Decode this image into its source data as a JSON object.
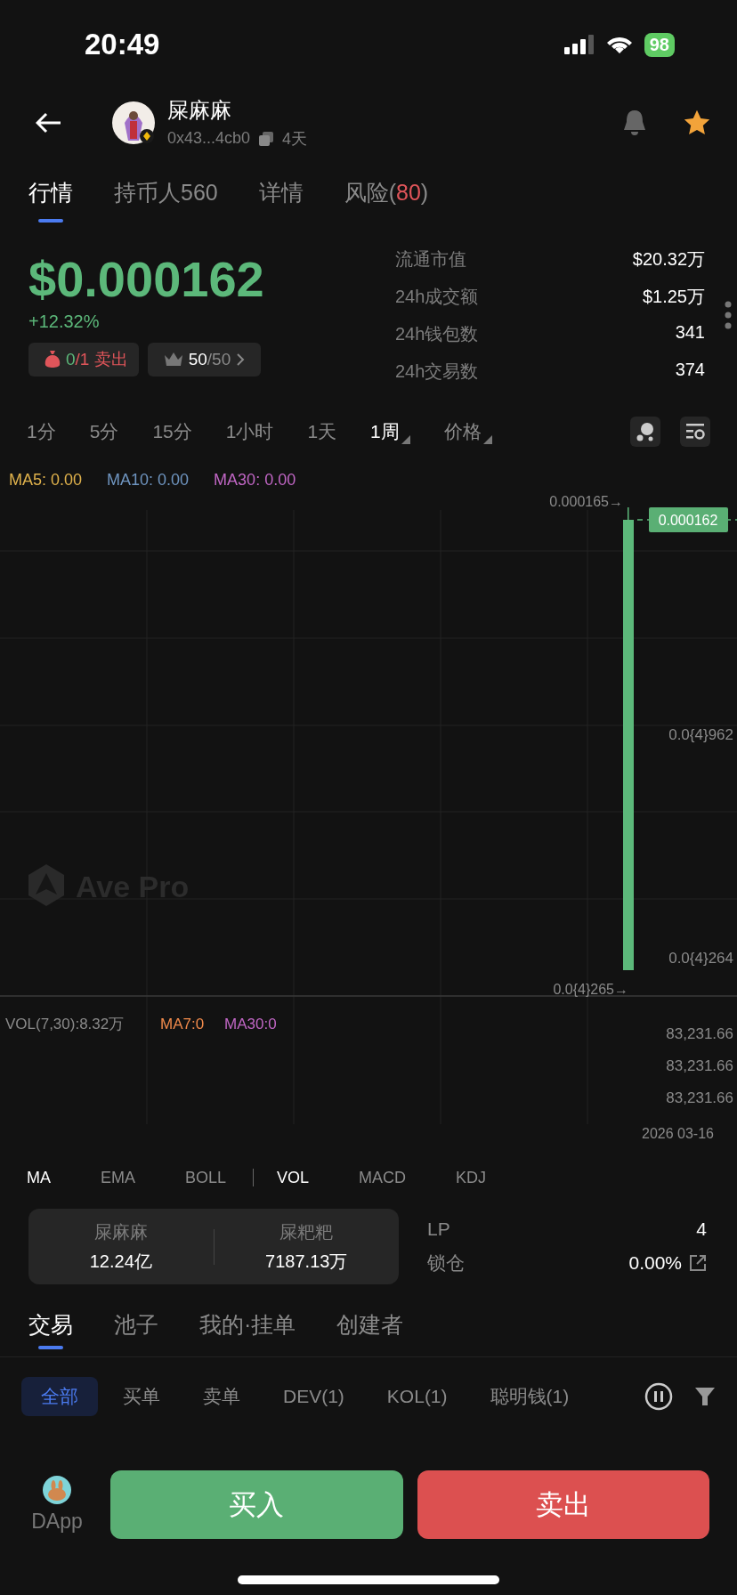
{
  "status_bar": {
    "time": "20:49",
    "battery": "98"
  },
  "header": {
    "token_name": "屎麻麻",
    "address": "0x43...4cb0",
    "age": "4天"
  },
  "tabs": [
    {
      "label": "行情",
      "selected": true
    },
    {
      "label": "持币人560",
      "selected": false
    },
    {
      "label": "详情",
      "selected": false
    },
    {
      "label": "风险(",
      "score": "80",
      "closing": ")",
      "selected": false
    }
  ],
  "price": {
    "value": "$0.000162",
    "change": "+12.32%",
    "trade_badge": {
      "buys": "0",
      "rest": "/1 卖出"
    },
    "top_badge": {
      "count": "50",
      "total": "/50"
    }
  },
  "stats": [
    {
      "label": "流通市值",
      "value": "$20.32万"
    },
    {
      "label": "24h成交额",
      "value": "$1.25万"
    },
    {
      "label": "24h钱包数",
      "value": "341"
    },
    {
      "label": "24h交易数",
      "value": "374"
    }
  ],
  "timeframes": [
    {
      "label": "1分",
      "selected": false,
      "dropdown": false
    },
    {
      "label": "5分",
      "selected": false,
      "dropdown": false
    },
    {
      "label": "15分",
      "selected": false,
      "dropdown": false
    },
    {
      "label": "1小时",
      "selected": false,
      "dropdown": false
    },
    {
      "label": "1天",
      "selected": false,
      "dropdown": false
    },
    {
      "label": "1周",
      "selected": true,
      "dropdown": true
    },
    {
      "label": "价格",
      "selected": false,
      "dropdown": true
    }
  ],
  "ma_legend": [
    {
      "label": "MA5: 0.00",
      "color": "#e0b24c"
    },
    {
      "label": "MA10: 0.00",
      "color": "#6f95c0"
    },
    {
      "label": "MA30: 0.00",
      "color": "#c066c4"
    }
  ],
  "price_chart": {
    "high_marker": "0.000165→",
    "last_price": "0.000162",
    "axis_labels": [
      "0.0{4}962",
      "0.0{4}264"
    ],
    "low_marker": "0.0{4}265→",
    "watermark": "Ave Pro"
  },
  "volume_chart": {
    "legend": "VOL(7,30):8.32万",
    "ma": [
      {
        "label": "MA7:0",
        "color": "#f08a4b"
      },
      {
        "label": "MA30:0",
        "color": "#c066c4"
      }
    ],
    "axis_labels": [
      "83,231.66",
      "83,231.66",
      "83,231.66"
    ],
    "date": "2026 03-16"
  },
  "indicator_groups": [
    [
      {
        "label": "MA",
        "selected": true
      },
      {
        "label": "EMA",
        "selected": false
      },
      {
        "label": "BOLL",
        "selected": false
      }
    ],
    [
      {
        "label": "VOL",
        "selected": true
      },
      {
        "label": "MACD",
        "selected": false
      },
      {
        "label": "KDJ",
        "selected": false
      }
    ]
  ],
  "pool": {
    "tokens": [
      {
        "name": "屎麻麻",
        "amount": "12.24亿"
      },
      {
        "name": "屎粑粑",
        "amount": "7187.13万"
      }
    ],
    "lp_label": "LP",
    "lp_value": "4",
    "lock_label": "锁仓",
    "lock_value": "0.00%"
  },
  "trade_tabs": [
    {
      "label": "交易",
      "selected": true
    },
    {
      "label": "池子",
      "selected": false
    },
    {
      "label": "我的·挂单",
      "selected": false
    },
    {
      "label": "创建者",
      "selected": false
    }
  ],
  "filters": [
    {
      "label": "全部",
      "selected": true
    },
    {
      "label": "买单",
      "selected": false
    },
    {
      "label": "卖单",
      "selected": false
    },
    {
      "label": "DEV(1)",
      "selected": false
    },
    {
      "label": "KOL(1)",
      "selected": false
    },
    {
      "label": "聪明钱(1)",
      "selected": false
    }
  ],
  "bottom_bar": {
    "dapp_label": "DApp",
    "buy": "买入",
    "sell": "卖出"
  }
}
